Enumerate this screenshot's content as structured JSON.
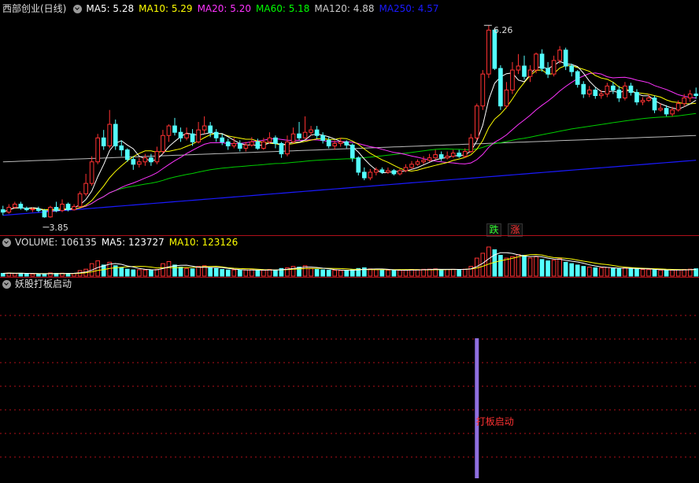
{
  "main": {
    "title": "西部创业(日线)",
    "ma": [
      {
        "label": "MA5: 5.28",
        "color": "#ffffff"
      },
      {
        "label": "MA10: 5.29",
        "color": "#ffff00"
      },
      {
        "label": "MA20: 5.20",
        "color": "#ff33ff"
      },
      {
        "label": "MA60: 5.18",
        "color": "#00ff00"
      },
      {
        "label": "MA120: 4.88",
        "color": "#cccccc"
      },
      {
        "label": "MA250: 4.57",
        "color": "#1a1aff"
      }
    ],
    "high_label": "6.26",
    "low_label": "3.85",
    "buttons": {
      "fall": "跌",
      "rise": "涨"
    }
  },
  "volume": {
    "title": "VOLUME: 106135",
    "ma": [
      {
        "label": "MA5: 123727",
        "color": "#ffffff"
      },
      {
        "label": "MA10: 123126",
        "color": "#ffff00"
      }
    ]
  },
  "indicator": {
    "title": "妖股打板启动",
    "signal_label": "打板启动"
  },
  "colors": {
    "up": "#ff3232",
    "down": "#54ffff",
    "grid": "#b0101a",
    "signal_bar": "#8f6fe0"
  },
  "chart_data": [
    {
      "type": "candlestick",
      "title": "西部创业(日线)",
      "ylim": [
        3.7,
        6.4
      ],
      "annotations": {
        "high": 6.26,
        "low": 3.85
      },
      "series": [
        {
          "name": "MA5",
          "last": 5.28
        },
        {
          "name": "MA10",
          "last": 5.29
        },
        {
          "name": "MA20",
          "last": 5.2
        },
        {
          "name": "MA60",
          "last": 5.18
        },
        {
          "name": "MA120",
          "last": 4.88
        },
        {
          "name": "MA250",
          "last": 4.57
        }
      ],
      "candles": [
        [
          3.95,
          3.92,
          4.0,
          3.88
        ],
        [
          3.92,
          3.98,
          4.02,
          3.9
        ],
        [
          3.98,
          4.02,
          4.05,
          3.96
        ],
        [
          4.02,
          3.97,
          4.05,
          3.95
        ],
        [
          3.97,
          3.95,
          3.99,
          3.93
        ],
        [
          3.95,
          3.96,
          3.98,
          3.92
        ],
        [
          3.96,
          3.94,
          3.99,
          3.92
        ],
        [
          3.94,
          3.86,
          3.96,
          3.85
        ],
        [
          3.86,
          3.98,
          4.0,
          3.85
        ],
        [
          3.98,
          3.94,
          4.05,
          3.92
        ],
        [
          3.94,
          4.02,
          4.08,
          3.92
        ],
        [
          4.02,
          3.95,
          4.04,
          3.93
        ],
        [
          3.95,
          3.99,
          4.02,
          3.94
        ],
        [
          3.99,
          4.15,
          4.18,
          3.98
        ],
        [
          4.15,
          4.28,
          4.4,
          4.12
        ],
        [
          4.28,
          4.55,
          4.62,
          4.25
        ],
        [
          4.55,
          4.85,
          4.9,
          4.52
        ],
        [
          4.85,
          4.75,
          4.95,
          4.7
        ],
        [
          4.75,
          5.02,
          5.2,
          4.72
        ],
        [
          5.02,
          4.75,
          5.08,
          4.7
        ],
        [
          4.75,
          4.7,
          4.82,
          4.62
        ],
        [
          4.7,
          4.58,
          4.72,
          4.55
        ],
        [
          4.58,
          4.52,
          4.62,
          4.45
        ],
        [
          4.52,
          4.55,
          4.6,
          4.48
        ],
        [
          4.55,
          4.6,
          4.65,
          4.5
        ],
        [
          4.6,
          4.55,
          4.65,
          4.5
        ],
        [
          4.55,
          4.68,
          4.74,
          4.52
        ],
        [
          4.68,
          4.88,
          4.95,
          4.65
        ],
        [
          4.88,
          5.0,
          5.02,
          4.8
        ],
        [
          5.0,
          4.92,
          5.1,
          4.88
        ],
        [
          4.92,
          4.85,
          4.98,
          4.8
        ],
        [
          4.85,
          4.9,
          4.98,
          4.82
        ],
        [
          4.9,
          4.8,
          4.96,
          4.75
        ],
        [
          4.8,
          4.95,
          5.05,
          4.78
        ],
        [
          4.95,
          5.0,
          5.12,
          4.9
        ],
        [
          5.0,
          4.92,
          5.05,
          4.86
        ],
        [
          4.92,
          4.85,
          4.96,
          4.8
        ],
        [
          4.85,
          4.8,
          4.9,
          4.76
        ],
        [
          4.8,
          4.75,
          4.84,
          4.7
        ],
        [
          4.75,
          4.78,
          4.85,
          4.72
        ],
        [
          4.78,
          4.72,
          4.82,
          4.68
        ],
        [
          4.72,
          4.76,
          4.8,
          4.68
        ],
        [
          4.76,
          4.8,
          4.86,
          4.74
        ],
        [
          4.8,
          4.72,
          4.84,
          4.7
        ],
        [
          4.72,
          4.8,
          4.85,
          4.7
        ],
        [
          4.8,
          4.85,
          4.92,
          4.78
        ],
        [
          4.85,
          4.78,
          4.88,
          4.72
        ],
        [
          4.78,
          4.65,
          4.8,
          4.6
        ],
        [
          4.65,
          4.8,
          4.88,
          4.62
        ],
        [
          4.8,
          4.9,
          4.98,
          4.78
        ],
        [
          4.9,
          4.85,
          5.05,
          4.82
        ],
        [
          4.85,
          4.92,
          5.12,
          4.84
        ],
        [
          4.92,
          4.95,
          5.0,
          4.88
        ],
        [
          4.95,
          4.88,
          5.0,
          4.84
        ],
        [
          4.88,
          4.82,
          4.92,
          4.78
        ],
        [
          4.82,
          4.75,
          4.86,
          4.72
        ],
        [
          4.75,
          4.78,
          4.82,
          4.7
        ],
        [
          4.78,
          4.8,
          4.85,
          4.74
        ],
        [
          4.8,
          4.76,
          4.82,
          4.72
        ],
        [
          4.76,
          4.6,
          4.78,
          4.55
        ],
        [
          4.6,
          4.42,
          4.62,
          4.38
        ],
        [
          4.42,
          4.35,
          4.48,
          4.32
        ],
        [
          4.35,
          4.42,
          4.46,
          4.32
        ],
        [
          4.42,
          4.45,
          4.48,
          4.38
        ],
        [
          4.45,
          4.42,
          4.48,
          4.4
        ],
        [
          4.42,
          4.44,
          4.48,
          4.4
        ],
        [
          4.44,
          4.4,
          4.46,
          4.38
        ],
        [
          4.4,
          4.44,
          4.46,
          4.38
        ],
        [
          4.44,
          4.48,
          4.52,
          4.42
        ],
        [
          4.48,
          4.52,
          4.56,
          4.46
        ],
        [
          4.52,
          4.55,
          4.58,
          4.5
        ],
        [
          4.55,
          4.57,
          4.62,
          4.52
        ],
        [
          4.57,
          4.6,
          4.65,
          4.55
        ],
        [
          4.6,
          4.64,
          4.7,
          4.58
        ],
        [
          4.64,
          4.6,
          4.68,
          4.56
        ],
        [
          4.6,
          4.62,
          4.68,
          4.58
        ],
        [
          4.62,
          4.66,
          4.7,
          4.6
        ],
        [
          4.66,
          4.62,
          4.7,
          4.6
        ],
        [
          4.62,
          4.68,
          4.72,
          4.6
        ],
        [
          4.68,
          4.85,
          4.9,
          4.66
        ],
        [
          4.85,
          5.25,
          5.28,
          4.82
        ],
        [
          5.25,
          5.65,
          5.7,
          5.2
        ],
        [
          5.65,
          6.2,
          6.26,
          5.6
        ],
        [
          6.2,
          5.72,
          6.22,
          5.7
        ],
        [
          5.72,
          5.25,
          5.76,
          5.2
        ],
        [
          5.25,
          5.45,
          5.55,
          5.22
        ],
        [
          5.45,
          5.7,
          5.8,
          5.4
        ],
        [
          5.7,
          5.75,
          5.9,
          5.65
        ],
        [
          5.75,
          5.62,
          5.88,
          5.58
        ],
        [
          5.62,
          5.7,
          5.76,
          5.55
        ],
        [
          5.7,
          5.9,
          5.92,
          5.66
        ],
        [
          5.9,
          5.72,
          5.96,
          5.68
        ],
        [
          5.72,
          5.65,
          5.8,
          5.6
        ],
        [
          5.65,
          5.82,
          5.88,
          5.62
        ],
        [
          5.82,
          5.95,
          6.0,
          5.78
        ],
        [
          5.95,
          5.75,
          5.98,
          5.7
        ],
        [
          5.75,
          5.68,
          5.78,
          5.62
        ],
        [
          5.68,
          5.52,
          5.7,
          5.48
        ],
        [
          5.52,
          5.4,
          5.56,
          5.35
        ],
        [
          5.4,
          5.45,
          5.5,
          5.36
        ],
        [
          5.45,
          5.38,
          5.48,
          5.34
        ],
        [
          5.38,
          5.4,
          5.45,
          5.34
        ],
        [
          5.4,
          5.5,
          5.54,
          5.36
        ],
        [
          5.5,
          5.45,
          5.55,
          5.4
        ],
        [
          5.45,
          5.35,
          5.5,
          5.3
        ],
        [
          5.35,
          5.5,
          5.55,
          5.32
        ],
        [
          5.5,
          5.42,
          5.54,
          5.38
        ],
        [
          5.42,
          5.3,
          5.46,
          5.26
        ],
        [
          5.3,
          5.32,
          5.36,
          5.26
        ],
        [
          5.32,
          5.35,
          5.4,
          5.3
        ],
        [
          5.35,
          5.2,
          5.38,
          5.16
        ],
        [
          5.2,
          5.22,
          5.28,
          5.18
        ],
        [
          5.22,
          5.15,
          5.26,
          5.12
        ],
        [
          5.15,
          5.2,
          5.24,
          5.12
        ],
        [
          5.2,
          5.28,
          5.32,
          5.18
        ],
        [
          5.28,
          5.35,
          5.4,
          5.24
        ],
        [
          5.35,
          5.4,
          5.45,
          5.3
        ],
        [
          5.4,
          5.38,
          5.48,
          5.34
        ]
      ]
    },
    {
      "type": "bar",
      "title": "VOLUME: 106135",
      "series": [
        {
          "name": "MA5",
          "last": 123727
        },
        {
          "name": "MA10",
          "last": 123126
        }
      ],
      "values": [
        40,
        45,
        38,
        42,
        36,
        30,
        28,
        34,
        46,
        40,
        42,
        36,
        38,
        80,
        100,
        180,
        220,
        160,
        200,
        150,
        120,
        100,
        90,
        92,
        88,
        90,
        96,
        180,
        210,
        160,
        130,
        110,
        104,
        140,
        150,
        120,
        110,
        96,
        88,
        90,
        86,
        88,
        92,
        80,
        86,
        96,
        88,
        110,
        120,
        140,
        130,
        150,
        110,
        96,
        90,
        86,
        84,
        80,
        82,
        90,
        110,
        120,
        104,
        92,
        88,
        86,
        80,
        84,
        90,
        96,
        94,
        98,
        100,
        104,
        92,
        96,
        98,
        94,
        100,
        140,
        260,
        330,
        420,
        380,
        300,
        260,
        280,
        310,
        300,
        260,
        280,
        240,
        220,
        230,
        250,
        200,
        180,
        160,
        140,
        130,
        120,
        118,
        124,
        110,
        104,
        120,
        110,
        100,
        96,
        94,
        88,
        86,
        84,
        88,
        92,
        96,
        100,
        106
      ]
    },
    {
      "type": "bar",
      "title": "妖股打板启动",
      "annotations": [
        "打板启动"
      ],
      "values": [
        0,
        0,
        0,
        0,
        0,
        0,
        0,
        0,
        0,
        0,
        0,
        0,
        0,
        0,
        0,
        0,
        0,
        0,
        0,
        0,
        0,
        0,
        0,
        0,
        0,
        0,
        0,
        0,
        0,
        0,
        0,
        0,
        0,
        0,
        0,
        0,
        0,
        0,
        0,
        0,
        0,
        0,
        0,
        0,
        0,
        0,
        0,
        0,
        0,
        0,
        0,
        0,
        0,
        0,
        0,
        0,
        0,
        0,
        0,
        0,
        0,
        0,
        0,
        0,
        0,
        0,
        0,
        0,
        0,
        0,
        0,
        0,
        0,
        0,
        0,
        0,
        0,
        0,
        0,
        0,
        1,
        0,
        0,
        0,
        0,
        0,
        0,
        0,
        0,
        0,
        0,
        0,
        0,
        0,
        0,
        0,
        0,
        0,
        0,
        0,
        0,
        0,
        0,
        0,
        0,
        0,
        0,
        0,
        0,
        0,
        0,
        0,
        0,
        0,
        0,
        0,
        0,
        0,
        0,
        0
      ]
    }
  ]
}
